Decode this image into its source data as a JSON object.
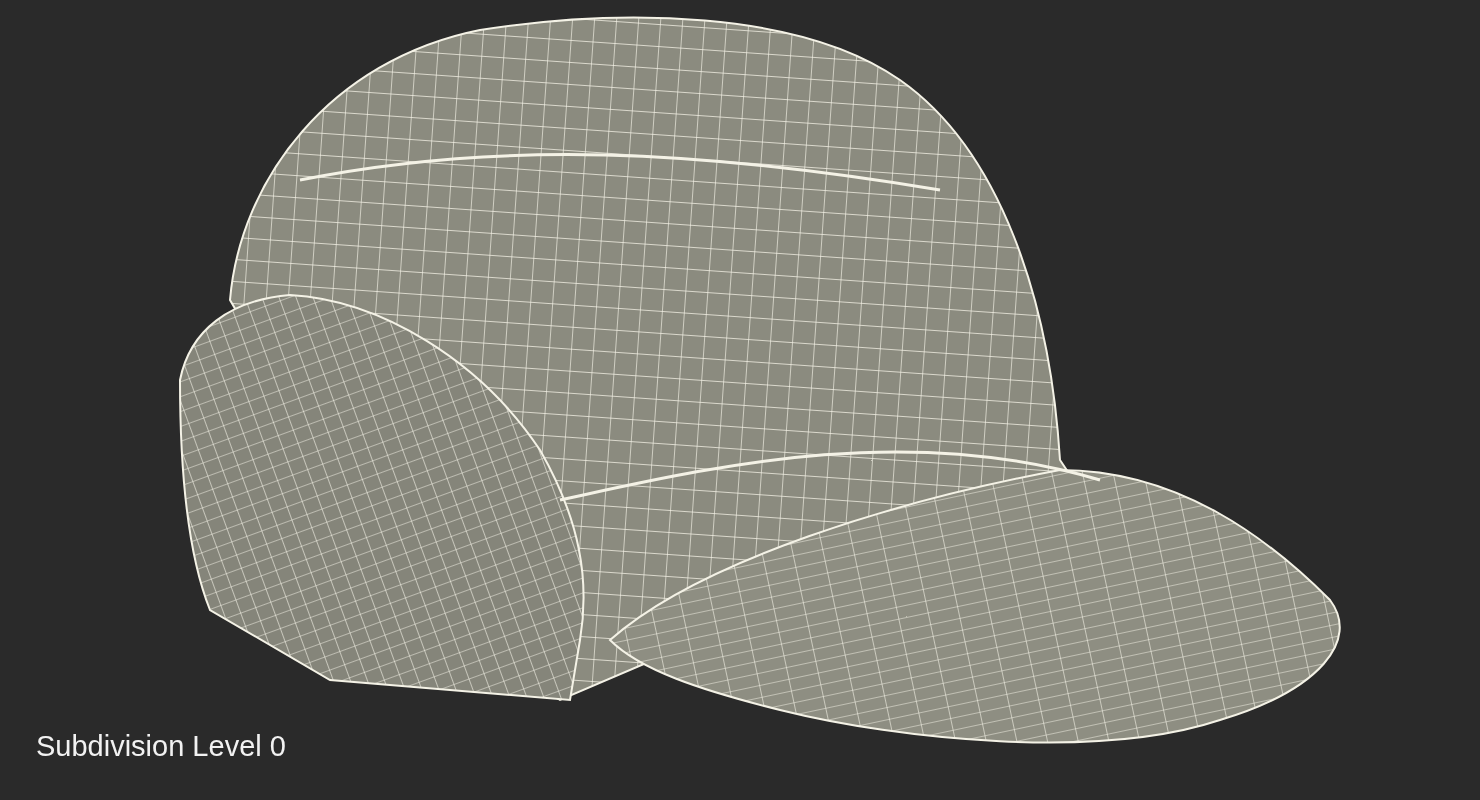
{
  "caption": "Subdivision Level 0"
}
